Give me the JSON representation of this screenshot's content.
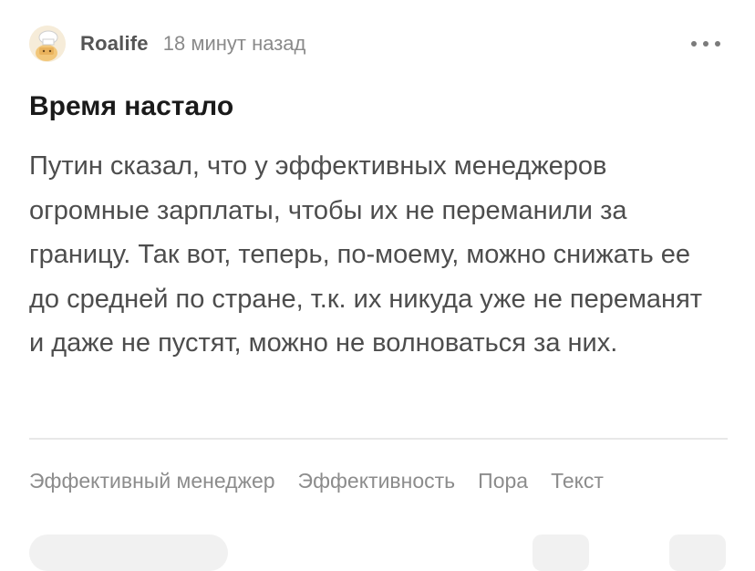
{
  "post": {
    "author": "Roalife",
    "time": "18 минут назад",
    "title": "Время настало",
    "body": "Путин сказал, что у эффективных менеджеров огромные зарплаты, чтобы их не переманили за границу. Так вот, теперь, по-моему, можно снижать ее до средней по стране, т.к. их никуда уже не переманят и даже не пустят, можно не волноваться за них.",
    "tags": [
      "Эффективный менеджер",
      "Эффективность",
      "Пора",
      "Текст"
    ]
  },
  "icons": {
    "avatar": "chef-avatar-icon",
    "more": "more-dots-icon"
  },
  "colors": {
    "author": "#555555",
    "meta": "#8a8a8a",
    "body": "#4d4d4d",
    "title": "#1a1a1a",
    "divider": "#e8e8e8"
  }
}
